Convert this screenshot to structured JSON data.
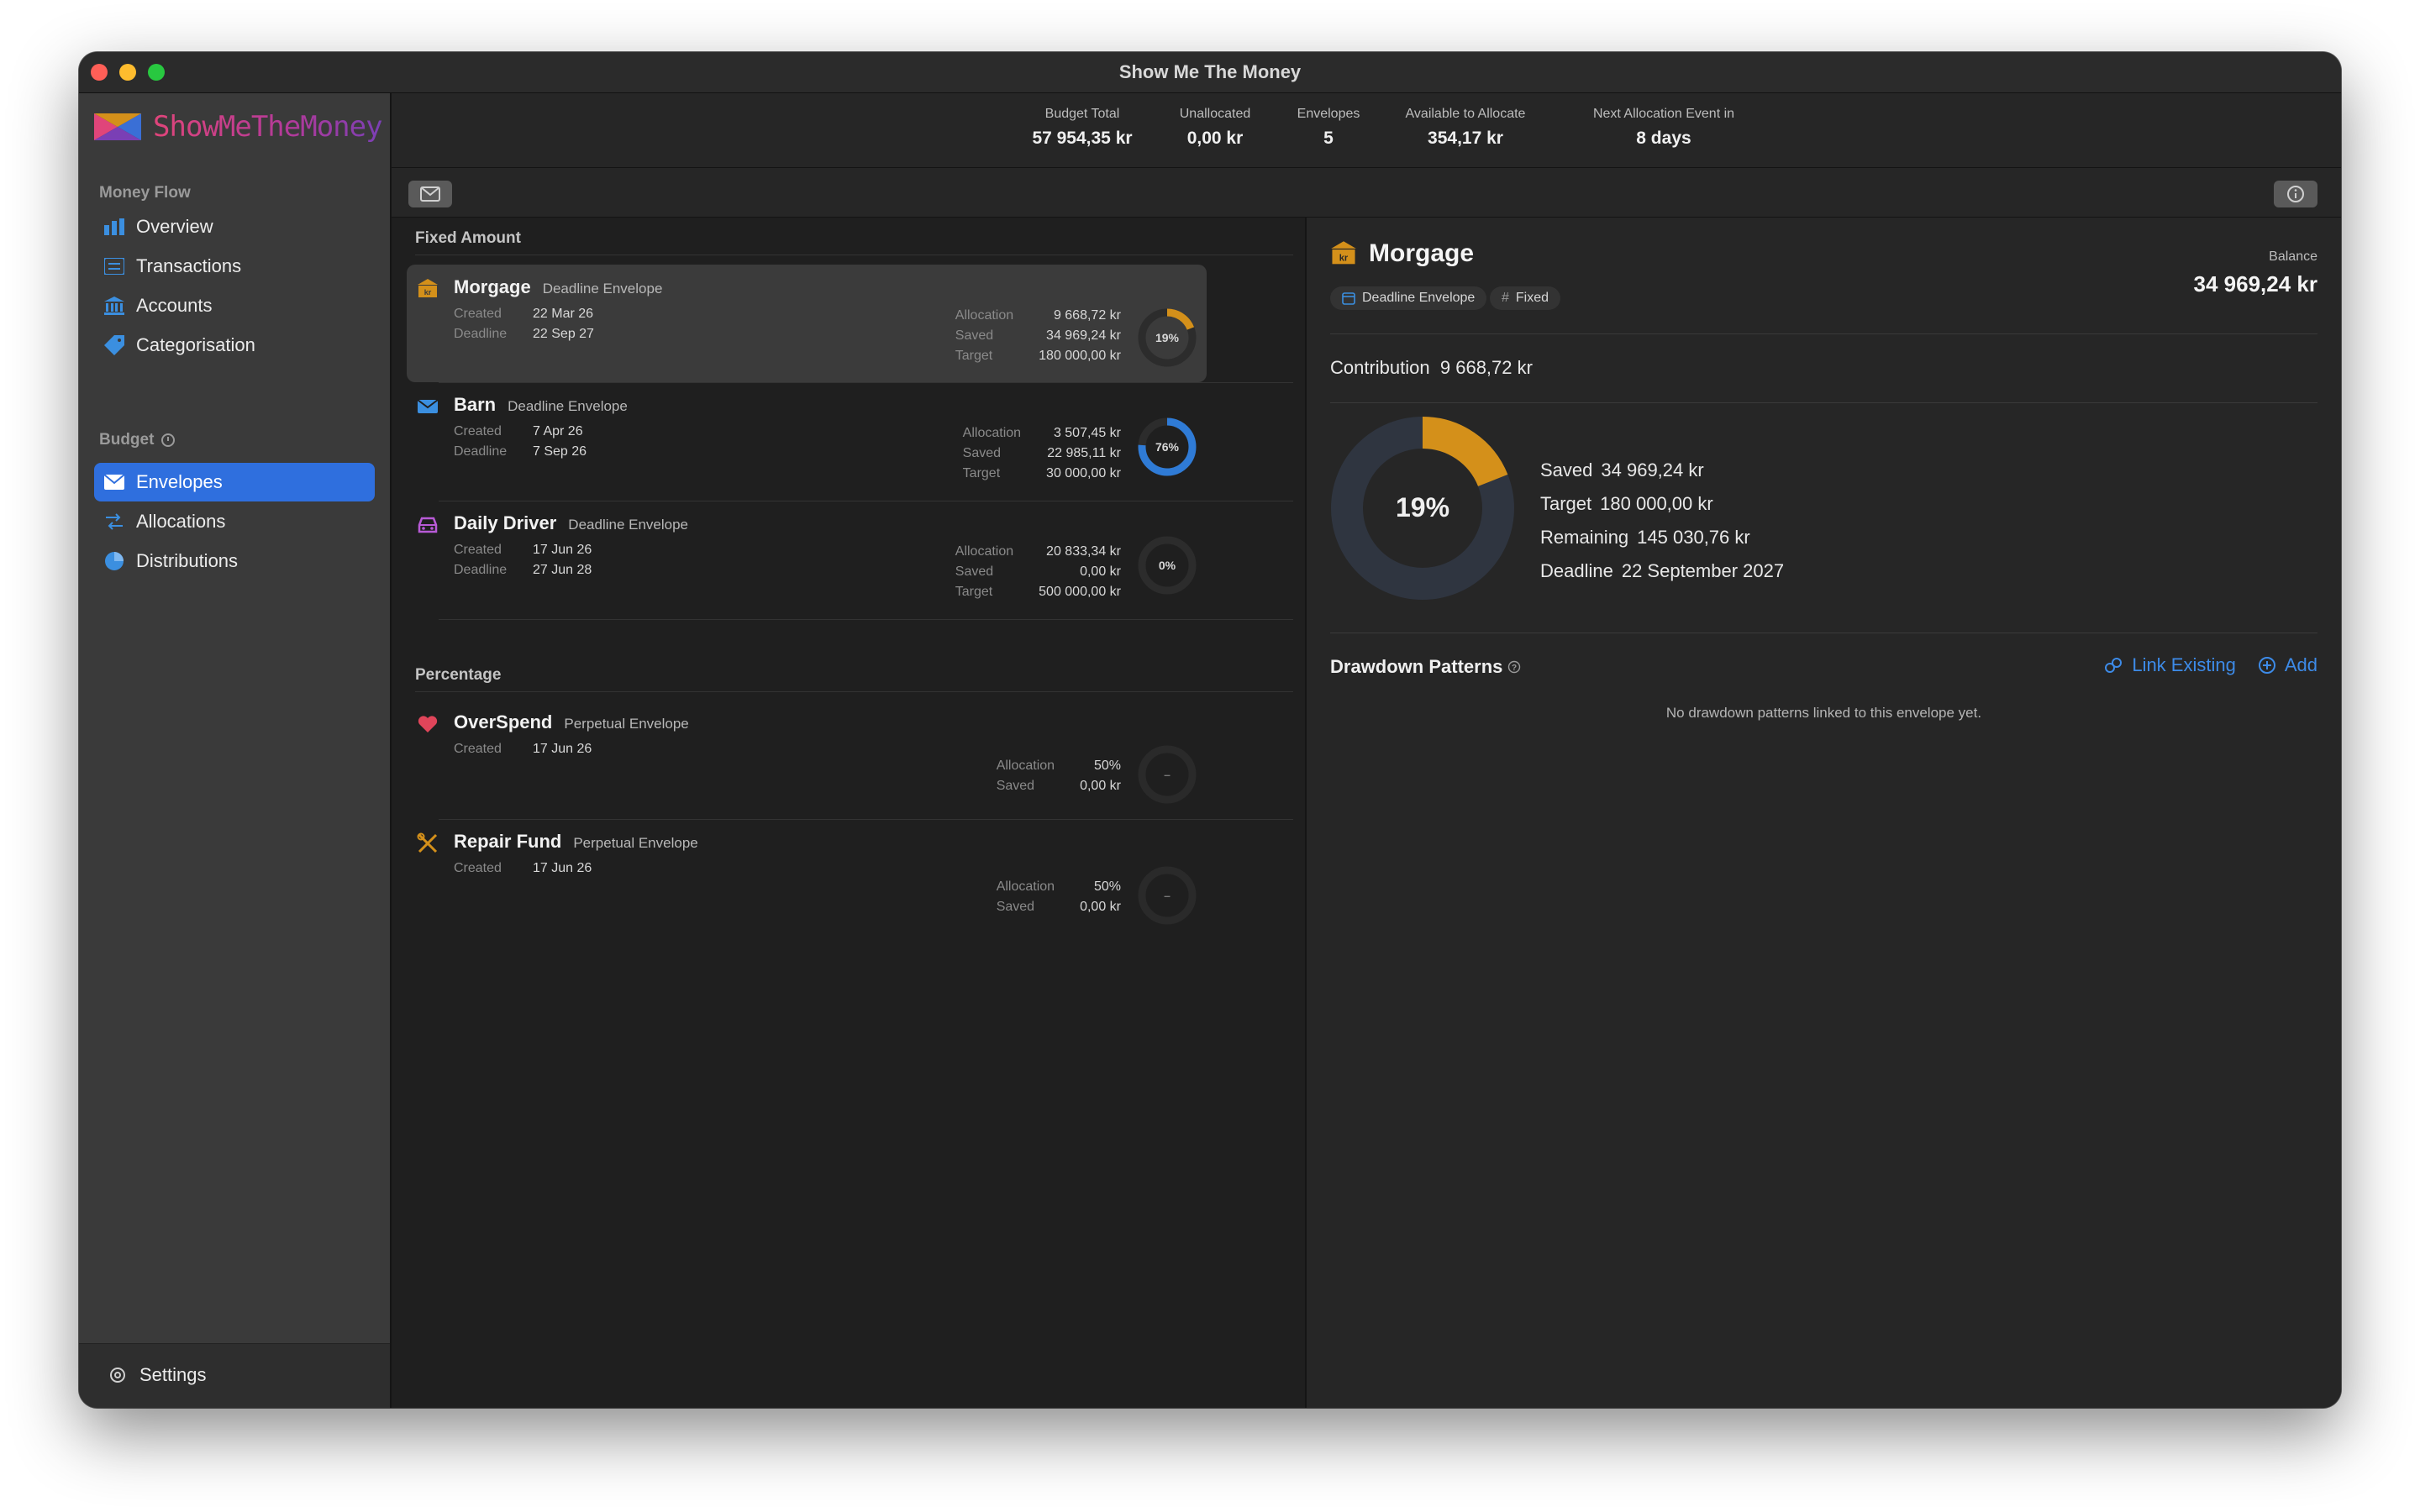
{
  "window": {
    "title": "Show Me The Money"
  },
  "sidebar": {
    "logo_text": "ShowMeTheMoney",
    "sections": [
      {
        "label": "Money Flow"
      },
      {
        "label": "Budget"
      }
    ],
    "items": [
      {
        "label": "Overview",
        "icon": "chart-bar-icon"
      },
      {
        "label": "Transactions",
        "icon": "list-icon"
      },
      {
        "label": "Accounts",
        "icon": "bank-icon"
      },
      {
        "label": "Categorisation",
        "icon": "tag-icon"
      },
      {
        "label": "Envelopes",
        "icon": "envelope-icon",
        "active": true
      },
      {
        "label": "Allocations",
        "icon": "arrows-icon"
      },
      {
        "label": "Distributions",
        "icon": "pie-icon"
      }
    ],
    "settings_label": "Settings"
  },
  "summary": {
    "budget_total": {
      "label": "Budget Total",
      "value": "57 954,35 kr"
    },
    "unallocated": {
      "label": "Unallocated",
      "value": "0,00 kr"
    },
    "envelopes": {
      "label": "Envelopes",
      "value": "5"
    },
    "available": {
      "label": "Available to Allocate",
      "value": "354,17 kr"
    },
    "next_event": {
      "label": "Next Allocation Event in",
      "value": "8 days"
    }
  },
  "list": {
    "fixed_header": "Fixed Amount",
    "percentage_header": "Percentage",
    "labels": {
      "created": "Created",
      "deadline": "Deadline",
      "allocation": "Allocation",
      "saved": "Saved",
      "target": "Target"
    },
    "fixed": [
      {
        "name": "Morgage",
        "kind": "Deadline Envelope",
        "icon": "bank-icon",
        "icon_color": "#d4901a",
        "created": "22 Mar 26",
        "deadline": "22 Sep 27",
        "allocation": "9 668,72 kr",
        "saved": "34 969,24 kr",
        "target": "180 000,00 kr",
        "progress": 0.19,
        "progress_label": "19%",
        "ring_color": "#d4901a",
        "selected": true
      },
      {
        "name": "Barn",
        "kind": "Deadline Envelope",
        "icon": "envelope-icon",
        "icon_color": "#3b8fe0",
        "created": "7 Apr 26",
        "deadline": "7 Sep 26",
        "allocation": "3 507,45 kr",
        "saved": "22 985,11 kr",
        "target": "30 000,00 kr",
        "progress": 0.76,
        "progress_label": "76%",
        "ring_color": "#2f7bd6"
      },
      {
        "name": "Daily Driver",
        "kind": "Deadline Envelope",
        "icon": "car-icon",
        "icon_color": "#b85ad6",
        "created": "17 Jun 26",
        "deadline": "27 Jun 28",
        "allocation": "20 833,34 kr",
        "saved": "0,00 kr",
        "target": "500 000,00 kr",
        "progress": 0.0,
        "progress_label": "0%",
        "ring_color": "#888888"
      }
    ],
    "percentage": [
      {
        "name": "OverSpend",
        "kind": "Perpetual Envelope",
        "icon": "heart-icon",
        "icon_color": "#e0455a",
        "created": "17 Jun 26",
        "allocation": "50%",
        "saved": "0,00 kr",
        "progress_label": "–"
      },
      {
        "name": "Repair Fund",
        "kind": "Perpetual Envelope",
        "icon": "tools-icon",
        "icon_color": "#d4901a",
        "created": "17 Jun 26",
        "allocation": "50%",
        "saved": "0,00 kr",
        "progress_label": "–"
      }
    ]
  },
  "detail": {
    "title": "Morgage",
    "tags": [
      {
        "label": "Deadline Envelope",
        "icon": "calendar-icon"
      },
      {
        "label": "Fixed",
        "icon": "hash-icon"
      }
    ],
    "balance_label": "Balance",
    "balance_value": "34 969,24 kr",
    "contribution_label": "Contribution",
    "contribution_value": "9 668,72 kr",
    "progress": 0.19,
    "progress_label": "19%",
    "ring_color": "#d4901a",
    "stats": [
      {
        "label": "Saved",
        "value": "34 969,24 kr"
      },
      {
        "label": "Target",
        "value": "180 000,00 kr"
      },
      {
        "label": "Remaining",
        "value": "145 030,76 kr"
      },
      {
        "label": "Deadline",
        "value": "22 September 2027"
      }
    ],
    "drawdown_title": "Drawdown Patterns",
    "link_existing_label": "Link Existing",
    "add_label": "Add",
    "empty_text": "No drawdown patterns linked to this envelope yet."
  }
}
